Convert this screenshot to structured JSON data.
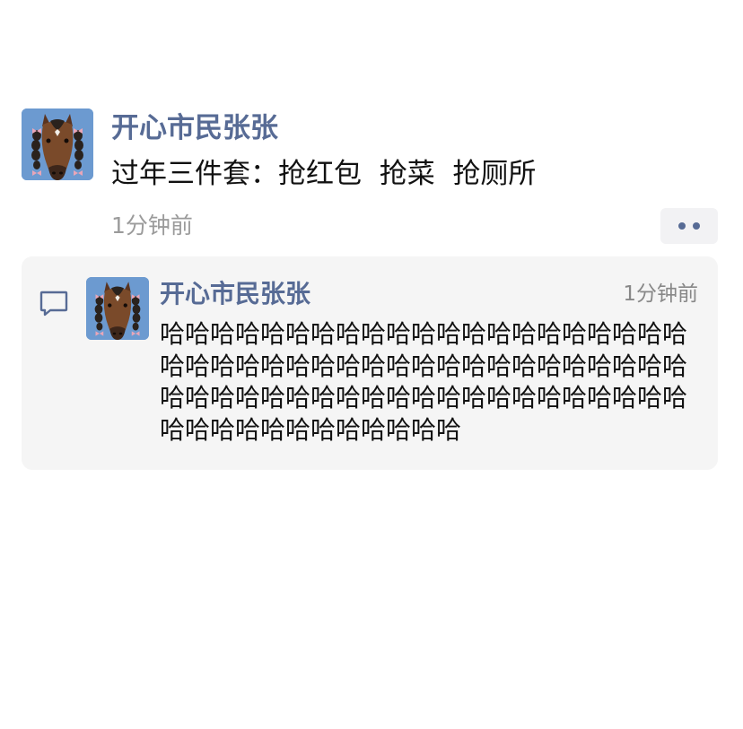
{
  "post": {
    "author": "开心市民张张",
    "text": "过年三件套：抢红包  抢菜  抢厕所",
    "time": "1分钟前",
    "avatar_icon": "horse-avatar",
    "more_icon": "more-dots-icon"
  },
  "comment": {
    "icon": "comment-icon",
    "author": "开心市民张张",
    "time": "1分钟前",
    "text": "哈哈哈哈哈哈哈哈哈哈哈哈哈哈哈哈哈哈哈哈哈哈哈哈哈哈哈哈哈哈哈哈哈哈哈哈哈哈哈哈哈哈哈哈哈哈哈哈哈哈哈哈哈哈哈哈哈哈哈哈哈哈哈哈哈哈哈哈哈哈哈哈哈哈哈"
  },
  "colors": {
    "name": "#576b95",
    "time": "#9b9b9b",
    "comment_bg": "#f5f5f5"
  }
}
